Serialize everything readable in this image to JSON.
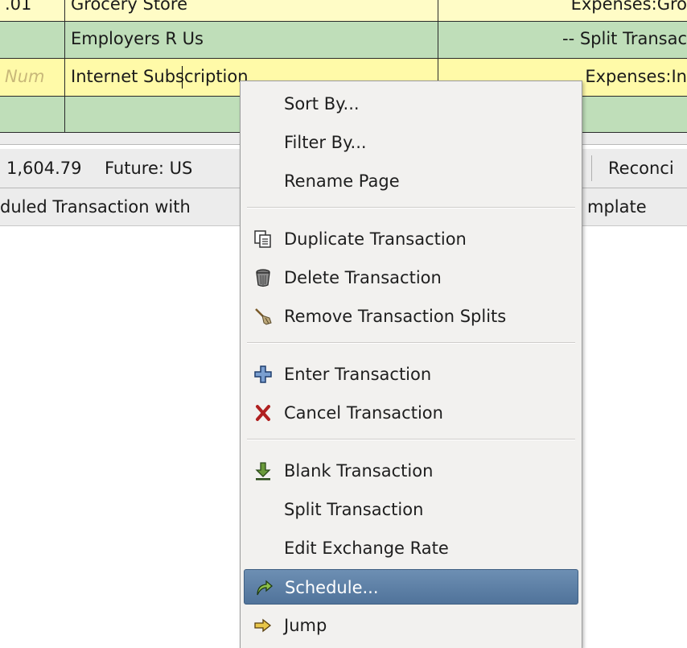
{
  "register": {
    "rows": [
      {
        "num": ".01",
        "description": "Grocery Store",
        "account": "Expenses:Gro"
      },
      {
        "num": "",
        "description": "Employers R Us",
        "account": "-- Split Transac"
      },
      {
        "num": "Num",
        "description": "Internet Subscription",
        "account": "Expenses:In"
      },
      {
        "num": "",
        "description": "",
        "account": ""
      }
    ]
  },
  "summary": {
    "present": "1,604.79",
    "future": "Future: US",
    "reconciled": "Reconci"
  },
  "statusbar": {
    "left": "duled Transaction with",
    "right": "mplate"
  },
  "menu": {
    "items": [
      {
        "id": "sort-by",
        "label": "Sort By...",
        "icon": ""
      },
      {
        "id": "filter-by",
        "label": "Filter By...",
        "icon": ""
      },
      {
        "id": "rename-page",
        "label": "Rename Page",
        "icon": ""
      },
      {
        "id": "duplicate-transaction",
        "label": "Duplicate Transaction",
        "icon": "duplicate-icon"
      },
      {
        "id": "delete-transaction",
        "label": "Delete Transaction",
        "icon": "trash-icon"
      },
      {
        "id": "remove-transaction-splits",
        "label": "Remove Transaction Splits",
        "icon": "broom-icon"
      },
      {
        "id": "enter-transaction",
        "label": "Enter Transaction",
        "icon": "plus-icon"
      },
      {
        "id": "cancel-transaction",
        "label": "Cancel Transaction",
        "icon": "cancel-icon"
      },
      {
        "id": "blank-transaction",
        "label": "Blank Transaction",
        "icon": "arrow-down-icon"
      },
      {
        "id": "split-transaction",
        "label": "Split Transaction",
        "icon": ""
      },
      {
        "id": "edit-exchange-rate",
        "label": "Edit Exchange Rate",
        "icon": ""
      },
      {
        "id": "schedule",
        "label": "Schedule...",
        "icon": "schedule-icon",
        "selected": true
      },
      {
        "id": "jump",
        "label": "Jump",
        "icon": "jump-icon"
      }
    ]
  },
  "colors": {
    "row_yellow": "#fffcc6",
    "row_green": "#bfdeb9",
    "row_current": "#fffaa8",
    "menu_bg": "#f2f1ef",
    "menu_selected": "#5a7ca3"
  }
}
